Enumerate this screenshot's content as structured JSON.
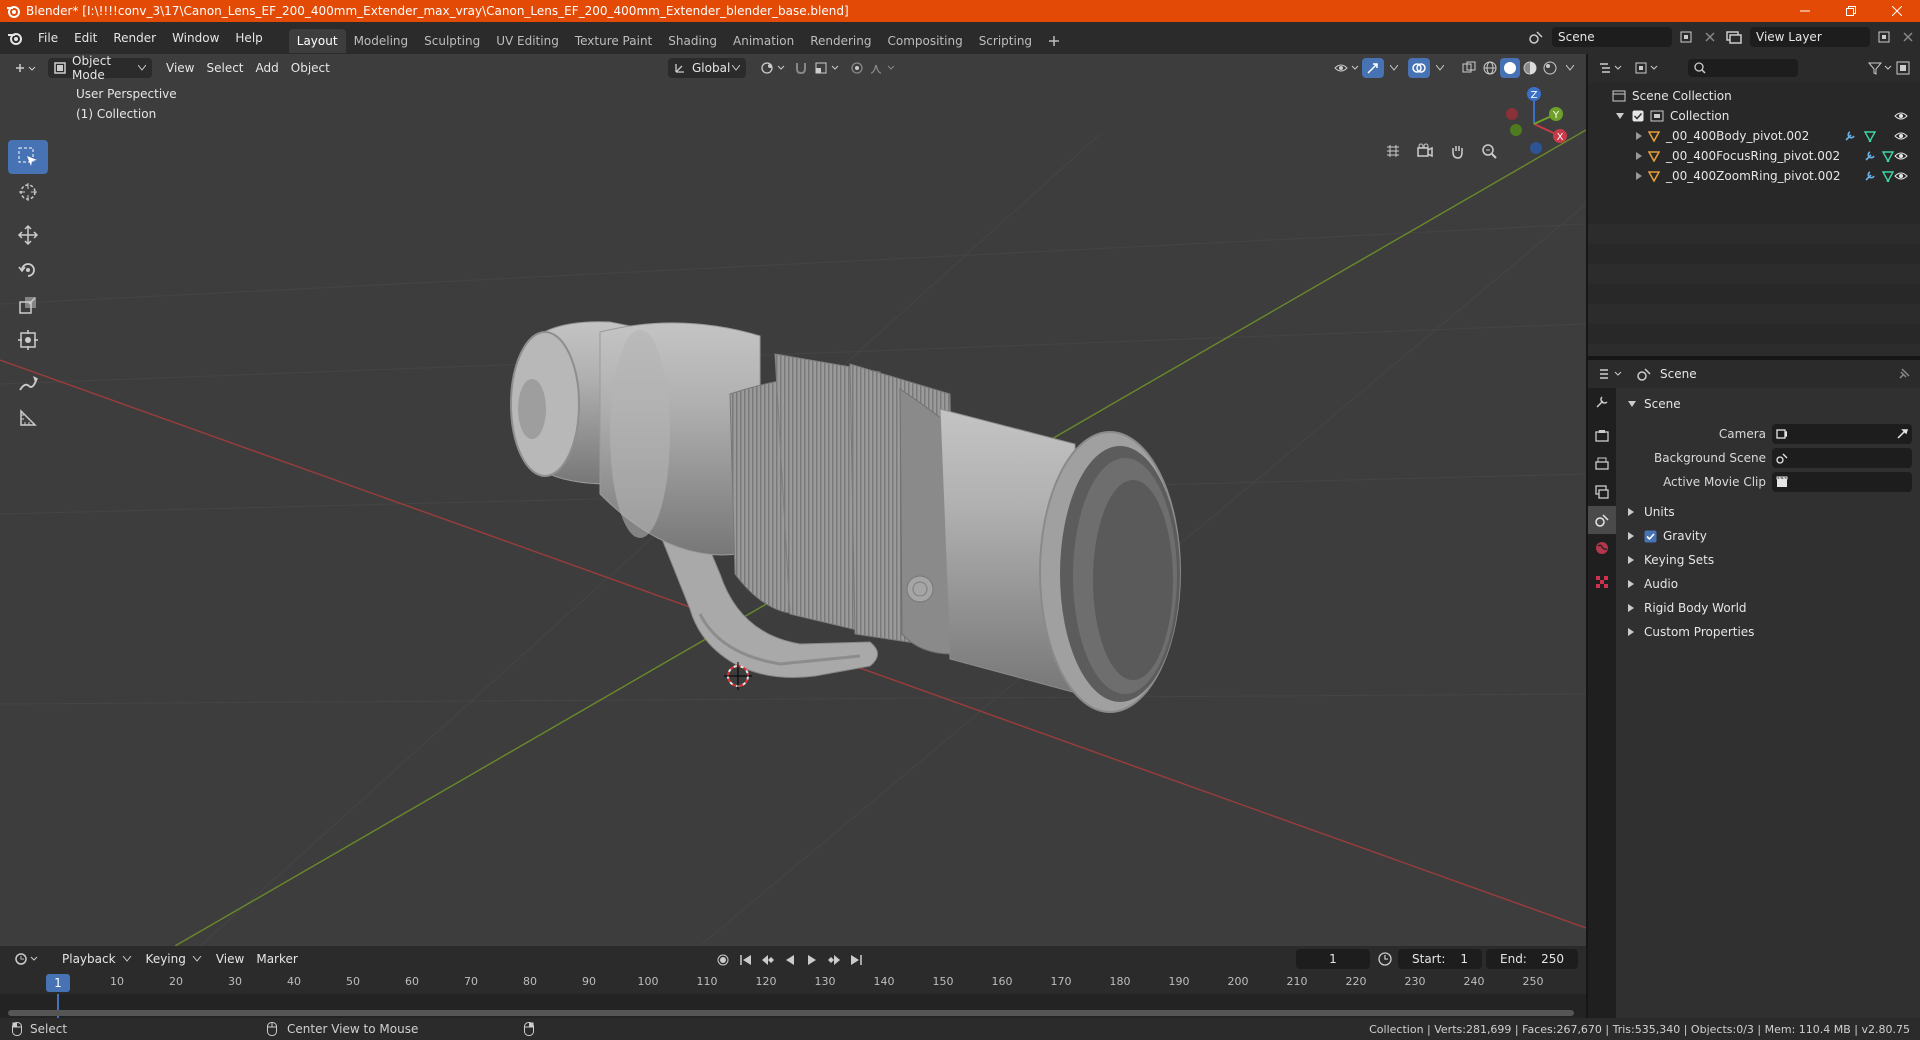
{
  "window": {
    "title": "Blender* [I:\\!!!!conv_3\\17\\Canon_Lens_EF_200_400mm_Extender_max_vray\\Canon_Lens_EF_200_400mm_Extender_blender_base.blend]",
    "accent": "#e24a06"
  },
  "menu": [
    "File",
    "Edit",
    "Render",
    "Window",
    "Help"
  ],
  "workspaces": [
    "Layout",
    "Modeling",
    "Sculpting",
    "UV Editing",
    "Texture Paint",
    "Shading",
    "Animation",
    "Rendering",
    "Compositing",
    "Scripting"
  ],
  "active_workspace": "Layout",
  "scene_selector": "Scene",
  "view_layer_selector": "View Layer",
  "viewport": {
    "mode": "Object Mode",
    "menus": [
      "View",
      "Select",
      "Add",
      "Object"
    ],
    "transform_orientation": "Global",
    "perspective_label": "User Perspective",
    "collection_label": "(1) Collection",
    "gizmo": {
      "x": "X",
      "y": "Y",
      "z": "Z"
    }
  },
  "outliner": {
    "root": "Scene Collection",
    "collection": "Collection",
    "objects": [
      "_00_400Body_pivot.002",
      "_00_400FocusRing_pivot.002",
      "_00_400ZoomRing_pivot.002"
    ]
  },
  "properties": {
    "header": "Scene",
    "section": "Scene",
    "fields": [
      {
        "label": "Camera"
      },
      {
        "label": "Background Scene"
      },
      {
        "label": "Active Movie Clip"
      }
    ],
    "subsections": [
      "Units",
      "Gravity",
      "Keying Sets",
      "Audio",
      "Rigid Body World",
      "Custom Properties"
    ],
    "gravity_checked": true
  },
  "timeline": {
    "menus": [
      "Playback",
      "Keying",
      "View",
      "Marker"
    ],
    "current_frame": "1",
    "start_label": "Start:",
    "start": "1",
    "end_label": "End:",
    "end": "250",
    "ticks": [
      "10",
      "20",
      "30",
      "40",
      "50",
      "60",
      "70",
      "80",
      "90",
      "100",
      "110",
      "120",
      "130",
      "140",
      "150",
      "160",
      "170",
      "180",
      "190",
      "200",
      "210",
      "220",
      "230",
      "240",
      "250"
    ]
  },
  "status": {
    "left_action": "Select",
    "middle_action": "Center View to Mouse",
    "stats": "Collection | Verts:281,699 | Faces:267,670 | Tris:535,340 | Objects:0/3 | Mem: 110.4 MB | v2.80.75"
  }
}
